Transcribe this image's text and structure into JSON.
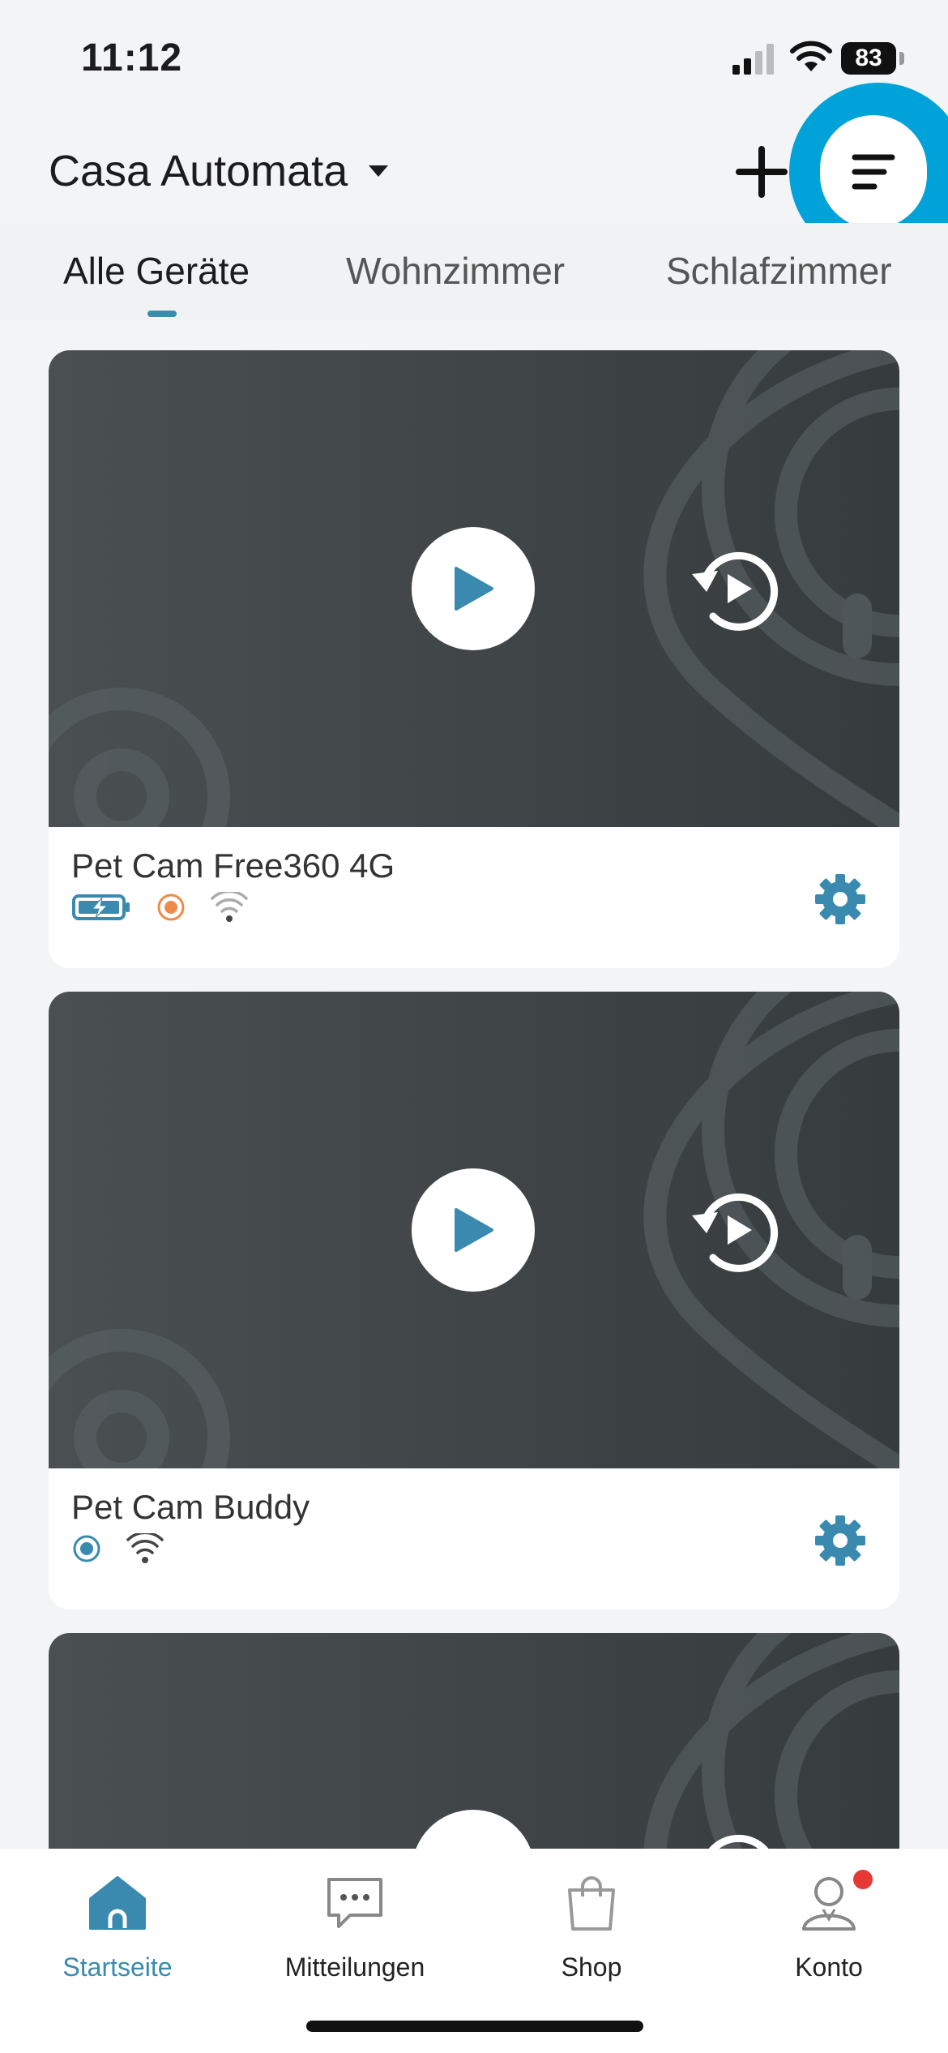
{
  "status": {
    "time": "11:12",
    "battery": "83"
  },
  "header": {
    "home_name": "Casa Automata"
  },
  "tabs": [
    {
      "label": "Alle Geräte"
    },
    {
      "label": "Wohnzimmer"
    },
    {
      "label": "Schlafzimmer"
    }
  ],
  "devices": [
    {
      "name": "Pet Cam Free360 4G"
    },
    {
      "name": "Pet Cam Buddy"
    }
  ],
  "nav": [
    {
      "label": "Startseite"
    },
    {
      "label": "Mitteilungen"
    },
    {
      "label": "Shop"
    },
    {
      "label": "Konto"
    }
  ],
  "colors": {
    "accent": "#3a8ab0",
    "highlight_ring": "#00a3d9",
    "recording_orange": "#f08a4b",
    "badge_red": "#e53935"
  }
}
